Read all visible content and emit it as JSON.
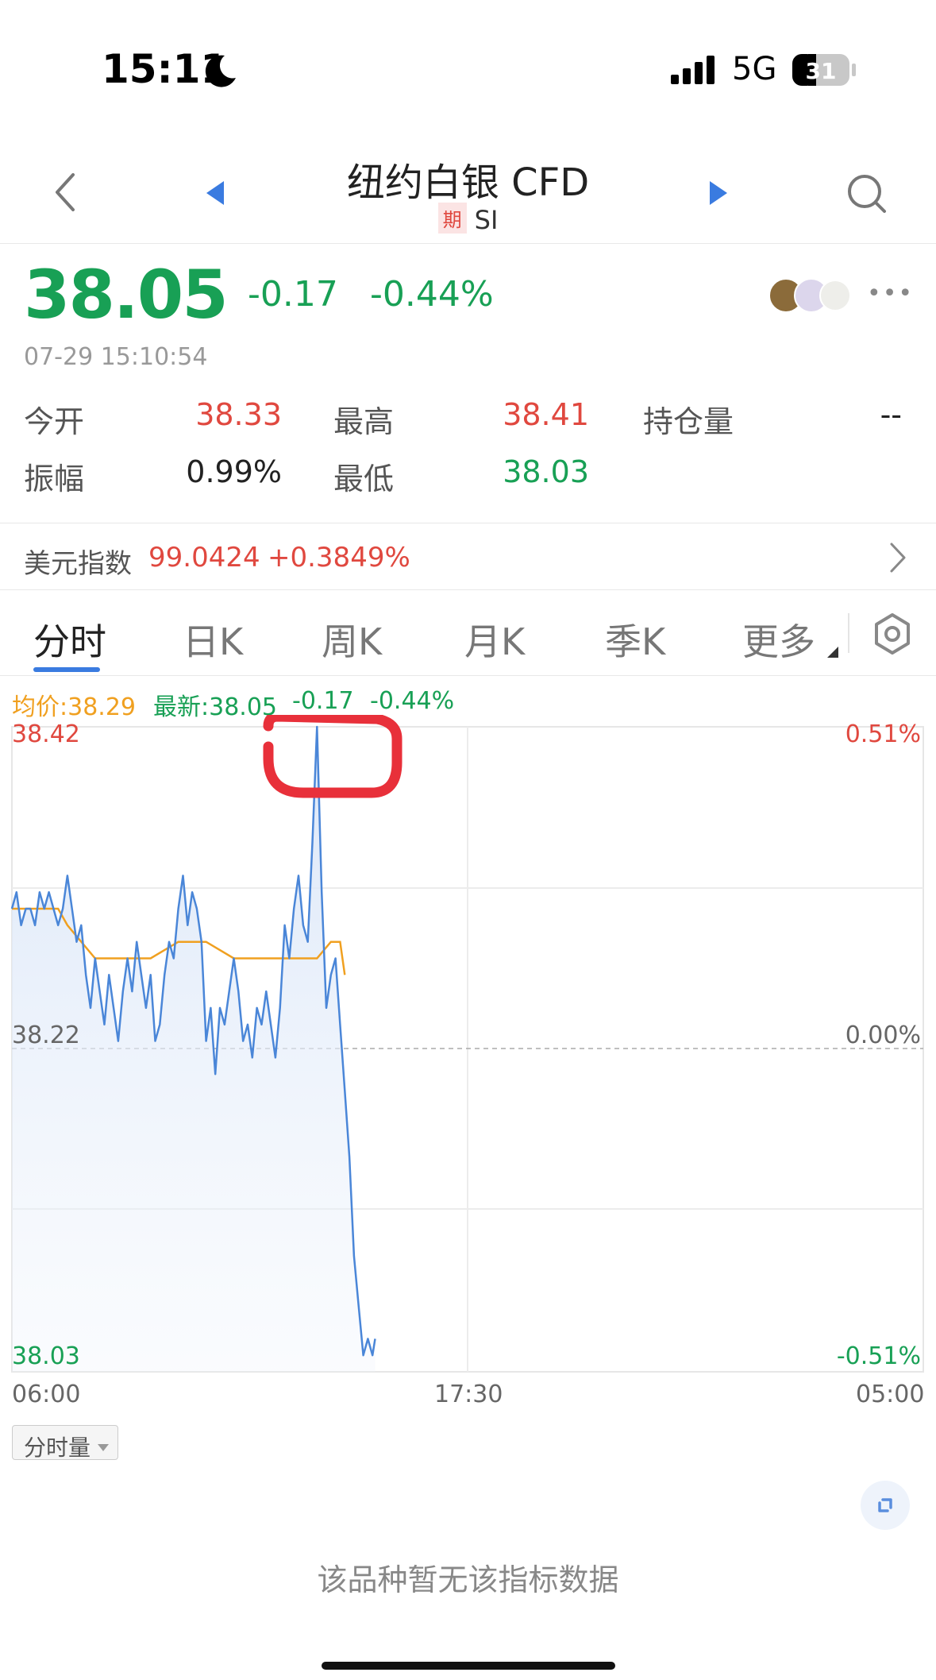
{
  "status_bar": {
    "time": "15:11",
    "network": "5G",
    "battery": "31"
  },
  "nav": {
    "title": "纽约白银 CFD",
    "badge": "期",
    "symbol": "SI"
  },
  "quote": {
    "price": "38.05",
    "change": "-0.17",
    "change_pct": "-0.44%",
    "timestamp": "07-29 15:10:54"
  },
  "stats": {
    "open_label": "今开",
    "open": "38.33",
    "high_label": "最高",
    "high": "38.41",
    "oi_label": "持仓量",
    "oi": "--",
    "amp_label": "振幅",
    "amp": "0.99%",
    "low_label": "最低",
    "low": "38.03"
  },
  "dxy": {
    "label": "美元指数",
    "value": "99.0424",
    "change": "+0.3849%"
  },
  "tabs": [
    "分时",
    "日K",
    "周K",
    "月K",
    "季K",
    "更多"
  ],
  "chart_header": {
    "avg": "均价:38.29",
    "latest": "最新:38.05",
    "change": "-0.17",
    "change_pct": "-0.44%"
  },
  "colors": {
    "up": "#e0483f",
    "down": "#18a055",
    "price_line": "#4a86d8",
    "avg_line": "#f0a020",
    "accent": "#3a7be0"
  },
  "chart_data": {
    "type": "line",
    "title": "",
    "xlabel": "",
    "ylabel": "",
    "ylim": [
      38.03,
      38.42
    ],
    "y_ticks_left": [
      "38.42",
      "38.22",
      "38.03"
    ],
    "y_ticks_right": [
      "0.51%",
      "0.00%",
      "-0.51%"
    ],
    "x_ticks": [
      "06:00",
      "17:30",
      "05:00"
    ],
    "baseline": 38.22,
    "x_domain": [
      "06:00",
      "05:00"
    ],
    "series": [
      {
        "name": "最新",
        "x": [
          "06:00",
          "06:07",
          "06:14",
          "06:21",
          "06:28",
          "06:35",
          "06:42",
          "06:49",
          "06:56",
          "07:03",
          "07:10",
          "07:17",
          "07:24",
          "07:31",
          "07:38",
          "07:45",
          "07:52",
          "07:59",
          "08:06",
          "08:13",
          "08:20",
          "08:27",
          "08:34",
          "08:41",
          "08:48",
          "08:55",
          "09:02",
          "09:09",
          "09:16",
          "09:23",
          "09:30",
          "09:37",
          "09:44",
          "09:51",
          "09:58",
          "10:05",
          "10:12",
          "10:19",
          "10:26",
          "10:33",
          "10:40",
          "10:47",
          "10:54",
          "11:01",
          "11:08",
          "11:15",
          "11:22",
          "11:29",
          "11:36",
          "11:43",
          "11:50",
          "11:57",
          "12:04",
          "12:11",
          "12:18",
          "12:25",
          "12:32",
          "12:39",
          "12:46",
          "12:53",
          "13:00",
          "13:07",
          "13:14",
          "13:21",
          "13:28",
          "13:35",
          "13:42",
          "13:49",
          "13:56",
          "14:03",
          "14:10",
          "14:17",
          "14:24",
          "14:31",
          "14:38",
          "14:45",
          "14:52",
          "14:59",
          "15:06",
          "15:10"
        ],
        "y": [
          38.31,
          38.32,
          38.3,
          38.31,
          38.31,
          38.3,
          38.32,
          38.31,
          38.32,
          38.31,
          38.3,
          38.31,
          38.33,
          38.31,
          38.29,
          38.3,
          38.27,
          38.25,
          38.28,
          38.26,
          38.24,
          38.27,
          38.25,
          38.23,
          38.26,
          38.28,
          38.26,
          38.29,
          38.27,
          38.25,
          38.27,
          38.23,
          38.24,
          38.27,
          38.29,
          38.28,
          38.31,
          38.33,
          38.3,
          38.32,
          38.31,
          38.29,
          38.23,
          38.25,
          38.21,
          38.25,
          38.24,
          38.26,
          38.28,
          38.26,
          38.23,
          38.24,
          38.22,
          38.25,
          38.24,
          38.26,
          38.24,
          38.22,
          38.25,
          38.3,
          38.28,
          38.31,
          38.33,
          38.3,
          38.29,
          38.35,
          38.42,
          38.32,
          38.25,
          38.27,
          38.28,
          38.24,
          38.2,
          38.16,
          38.1,
          38.07,
          38.04,
          38.05,
          38.04,
          38.05
        ]
      },
      {
        "name": "均价",
        "x": [
          "06:00",
          "06:35",
          "07:10",
          "07:24",
          "08:06",
          "08:48",
          "09:30",
          "10:12",
          "10:54",
          "11:36",
          "12:18",
          "13:00",
          "13:42",
          "14:03",
          "14:17",
          "14:24"
        ],
        "y": [
          38.31,
          38.31,
          38.31,
          38.3,
          38.28,
          38.28,
          38.28,
          38.29,
          38.29,
          38.28,
          38.28,
          38.28,
          38.28,
          38.29,
          38.29,
          38.27
        ]
      }
    ]
  },
  "volume_selector": "分时量",
  "no_data_text": "该品种暂无该指标数据"
}
